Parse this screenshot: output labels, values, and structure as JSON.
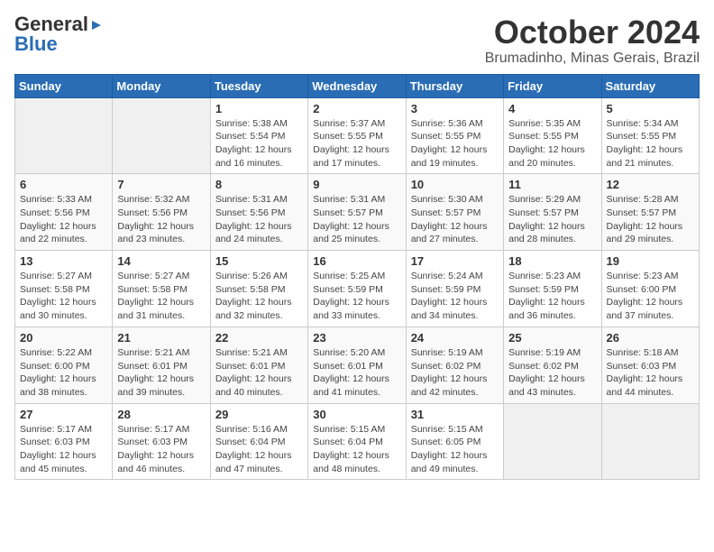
{
  "header": {
    "logo_general": "General",
    "logo_blue": "Blue",
    "month_title": "October 2024",
    "location": "Brumadinho, Minas Gerais, Brazil"
  },
  "calendar": {
    "days_of_week": [
      "Sunday",
      "Monday",
      "Tuesday",
      "Wednesday",
      "Thursday",
      "Friday",
      "Saturday"
    ],
    "weeks": [
      [
        {
          "day": "",
          "sunrise": "",
          "sunset": "",
          "daylight": ""
        },
        {
          "day": "",
          "sunrise": "",
          "sunset": "",
          "daylight": ""
        },
        {
          "day": "1",
          "sunrise": "Sunrise: 5:38 AM",
          "sunset": "Sunset: 5:54 PM",
          "daylight": "Daylight: 12 hours and 16 minutes."
        },
        {
          "day": "2",
          "sunrise": "Sunrise: 5:37 AM",
          "sunset": "Sunset: 5:55 PM",
          "daylight": "Daylight: 12 hours and 17 minutes."
        },
        {
          "day": "3",
          "sunrise": "Sunrise: 5:36 AM",
          "sunset": "Sunset: 5:55 PM",
          "daylight": "Daylight: 12 hours and 19 minutes."
        },
        {
          "day": "4",
          "sunrise": "Sunrise: 5:35 AM",
          "sunset": "Sunset: 5:55 PM",
          "daylight": "Daylight: 12 hours and 20 minutes."
        },
        {
          "day": "5",
          "sunrise": "Sunrise: 5:34 AM",
          "sunset": "Sunset: 5:55 PM",
          "daylight": "Daylight: 12 hours and 21 minutes."
        }
      ],
      [
        {
          "day": "6",
          "sunrise": "Sunrise: 5:33 AM",
          "sunset": "Sunset: 5:56 PM",
          "daylight": "Daylight: 12 hours and 22 minutes."
        },
        {
          "day": "7",
          "sunrise": "Sunrise: 5:32 AM",
          "sunset": "Sunset: 5:56 PM",
          "daylight": "Daylight: 12 hours and 23 minutes."
        },
        {
          "day": "8",
          "sunrise": "Sunrise: 5:31 AM",
          "sunset": "Sunset: 5:56 PM",
          "daylight": "Daylight: 12 hours and 24 minutes."
        },
        {
          "day": "9",
          "sunrise": "Sunrise: 5:31 AM",
          "sunset": "Sunset: 5:57 PM",
          "daylight": "Daylight: 12 hours and 25 minutes."
        },
        {
          "day": "10",
          "sunrise": "Sunrise: 5:30 AM",
          "sunset": "Sunset: 5:57 PM",
          "daylight": "Daylight: 12 hours and 27 minutes."
        },
        {
          "day": "11",
          "sunrise": "Sunrise: 5:29 AM",
          "sunset": "Sunset: 5:57 PM",
          "daylight": "Daylight: 12 hours and 28 minutes."
        },
        {
          "day": "12",
          "sunrise": "Sunrise: 5:28 AM",
          "sunset": "Sunset: 5:57 PM",
          "daylight": "Daylight: 12 hours and 29 minutes."
        }
      ],
      [
        {
          "day": "13",
          "sunrise": "Sunrise: 5:27 AM",
          "sunset": "Sunset: 5:58 PM",
          "daylight": "Daylight: 12 hours and 30 minutes."
        },
        {
          "day": "14",
          "sunrise": "Sunrise: 5:27 AM",
          "sunset": "Sunset: 5:58 PM",
          "daylight": "Daylight: 12 hours and 31 minutes."
        },
        {
          "day": "15",
          "sunrise": "Sunrise: 5:26 AM",
          "sunset": "Sunset: 5:58 PM",
          "daylight": "Daylight: 12 hours and 32 minutes."
        },
        {
          "day": "16",
          "sunrise": "Sunrise: 5:25 AM",
          "sunset": "Sunset: 5:59 PM",
          "daylight": "Daylight: 12 hours and 33 minutes."
        },
        {
          "day": "17",
          "sunrise": "Sunrise: 5:24 AM",
          "sunset": "Sunset: 5:59 PM",
          "daylight": "Daylight: 12 hours and 34 minutes."
        },
        {
          "day": "18",
          "sunrise": "Sunrise: 5:23 AM",
          "sunset": "Sunset: 5:59 PM",
          "daylight": "Daylight: 12 hours and 36 minutes."
        },
        {
          "day": "19",
          "sunrise": "Sunrise: 5:23 AM",
          "sunset": "Sunset: 6:00 PM",
          "daylight": "Daylight: 12 hours and 37 minutes."
        }
      ],
      [
        {
          "day": "20",
          "sunrise": "Sunrise: 5:22 AM",
          "sunset": "Sunset: 6:00 PM",
          "daylight": "Daylight: 12 hours and 38 minutes."
        },
        {
          "day": "21",
          "sunrise": "Sunrise: 5:21 AM",
          "sunset": "Sunset: 6:01 PM",
          "daylight": "Daylight: 12 hours and 39 minutes."
        },
        {
          "day": "22",
          "sunrise": "Sunrise: 5:21 AM",
          "sunset": "Sunset: 6:01 PM",
          "daylight": "Daylight: 12 hours and 40 minutes."
        },
        {
          "day": "23",
          "sunrise": "Sunrise: 5:20 AM",
          "sunset": "Sunset: 6:01 PM",
          "daylight": "Daylight: 12 hours and 41 minutes."
        },
        {
          "day": "24",
          "sunrise": "Sunrise: 5:19 AM",
          "sunset": "Sunset: 6:02 PM",
          "daylight": "Daylight: 12 hours and 42 minutes."
        },
        {
          "day": "25",
          "sunrise": "Sunrise: 5:19 AM",
          "sunset": "Sunset: 6:02 PM",
          "daylight": "Daylight: 12 hours and 43 minutes."
        },
        {
          "day": "26",
          "sunrise": "Sunrise: 5:18 AM",
          "sunset": "Sunset: 6:03 PM",
          "daylight": "Daylight: 12 hours and 44 minutes."
        }
      ],
      [
        {
          "day": "27",
          "sunrise": "Sunrise: 5:17 AM",
          "sunset": "Sunset: 6:03 PM",
          "daylight": "Daylight: 12 hours and 45 minutes."
        },
        {
          "day": "28",
          "sunrise": "Sunrise: 5:17 AM",
          "sunset": "Sunset: 6:03 PM",
          "daylight": "Daylight: 12 hours and 46 minutes."
        },
        {
          "day": "29",
          "sunrise": "Sunrise: 5:16 AM",
          "sunset": "Sunset: 6:04 PM",
          "daylight": "Daylight: 12 hours and 47 minutes."
        },
        {
          "day": "30",
          "sunrise": "Sunrise: 5:15 AM",
          "sunset": "Sunset: 6:04 PM",
          "daylight": "Daylight: 12 hours and 48 minutes."
        },
        {
          "day": "31",
          "sunrise": "Sunrise: 5:15 AM",
          "sunset": "Sunset: 6:05 PM",
          "daylight": "Daylight: 12 hours and 49 minutes."
        },
        {
          "day": "",
          "sunrise": "",
          "sunset": "",
          "daylight": ""
        },
        {
          "day": "",
          "sunrise": "",
          "sunset": "",
          "daylight": ""
        }
      ]
    ]
  }
}
